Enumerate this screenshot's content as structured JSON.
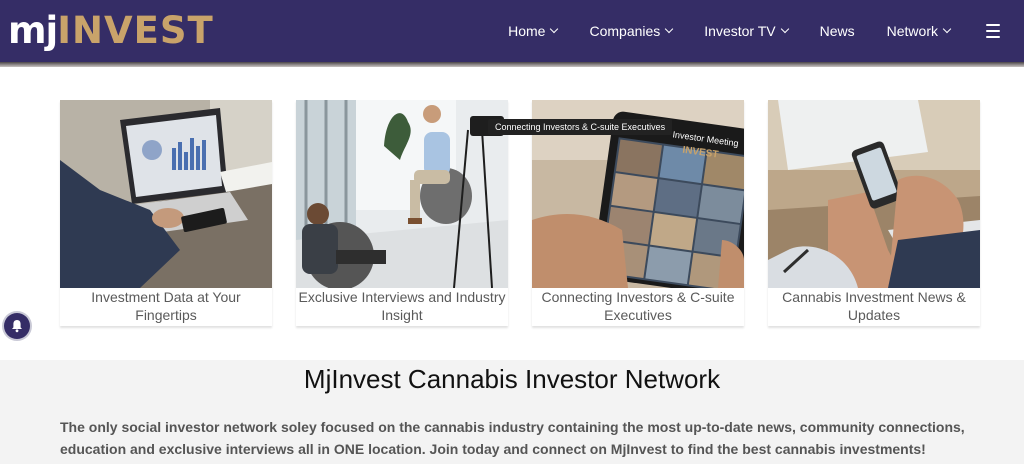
{
  "brand": {
    "logo_mj": "mj",
    "logo_invest": "INVEST",
    "accent": "#c9a36a",
    "nav_bg": "#352d66"
  },
  "nav": {
    "items": [
      {
        "label": "Home",
        "dropdown": true
      },
      {
        "label": "Companies",
        "dropdown": true
      },
      {
        "label": "Investor TV",
        "dropdown": true
      },
      {
        "label": "News",
        "dropdown": false
      },
      {
        "label": "Network",
        "dropdown": true
      }
    ],
    "menu_icon": "hamburger-icon"
  },
  "cards": [
    {
      "caption": "Investment Data at Your Fingertips",
      "image": "laptop-chart"
    },
    {
      "caption": "Exclusive Interviews and Industry Insight",
      "image": "interview-studio"
    },
    {
      "caption": "Connecting Investors & C-suite Executives",
      "image": "tablet-video-call"
    },
    {
      "caption": "Cannabis Investment News & Updates",
      "image": "phone-news"
    }
  ],
  "tooltip": "Connecting Investors & C-suite Executives",
  "tablet_overlay": {
    "line1": "Investor Meeting",
    "line2": "INVEST"
  },
  "notification_icon": "bell-icon",
  "section": {
    "heading": "MjInvest Cannabis Investor Network",
    "body": "The only social investor network soley focused on the cannabis industry containing the most up-to-date news, community connections, education and exclusive interviews all in ONE location.  Join today and connect on MjInvest to find the best cannabis investments!"
  }
}
